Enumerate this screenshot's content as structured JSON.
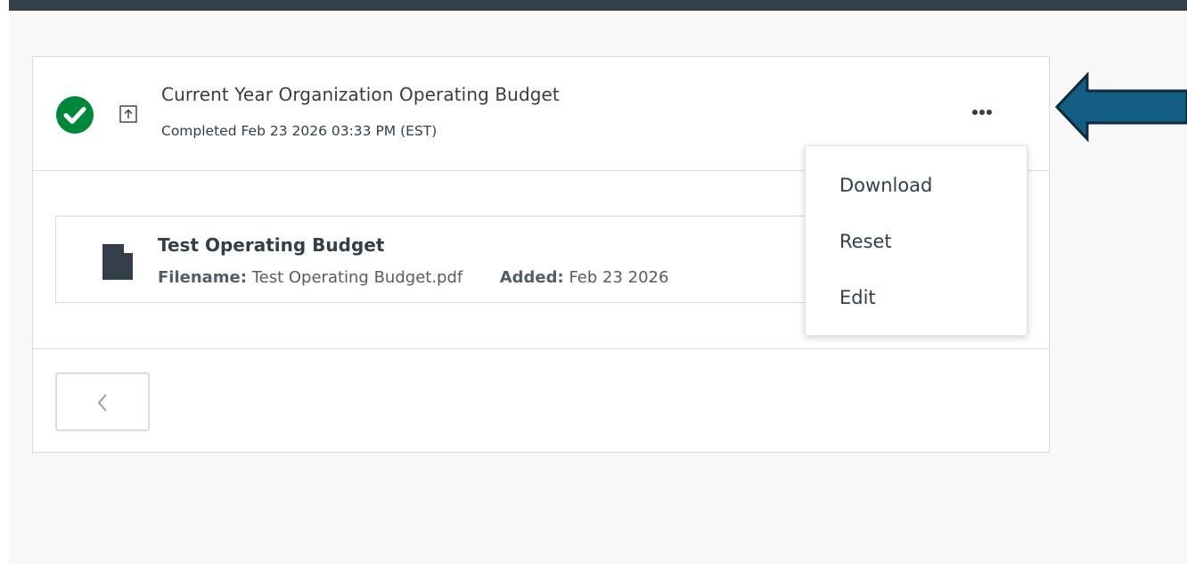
{
  "task": {
    "title": "Current Year Organization Operating Budget",
    "status": "Completed Feb 23 2026 03:33 PM (EST)",
    "status_color": "#00873c"
  },
  "file": {
    "name": "Test Operating Budget",
    "filename_label": "Filename:",
    "filename": "Test Operating Budget.pdf",
    "added_label": "Added:",
    "added": "Feb 23 2026"
  },
  "menu": {
    "items": [
      {
        "label": "Download"
      },
      {
        "label": "Reset"
      },
      {
        "label": "Edit"
      }
    ]
  },
  "icons": {
    "status": "check-circle-icon",
    "upload": "upload-icon",
    "more": "ellipsis-icon",
    "file": "document-icon",
    "back": "chevron-left-icon",
    "annotation": "left-arrow"
  },
  "colors": {
    "top_bar": "#323e48",
    "arrow_fill": "#135e82",
    "arrow_stroke": "#0d2a3a"
  }
}
